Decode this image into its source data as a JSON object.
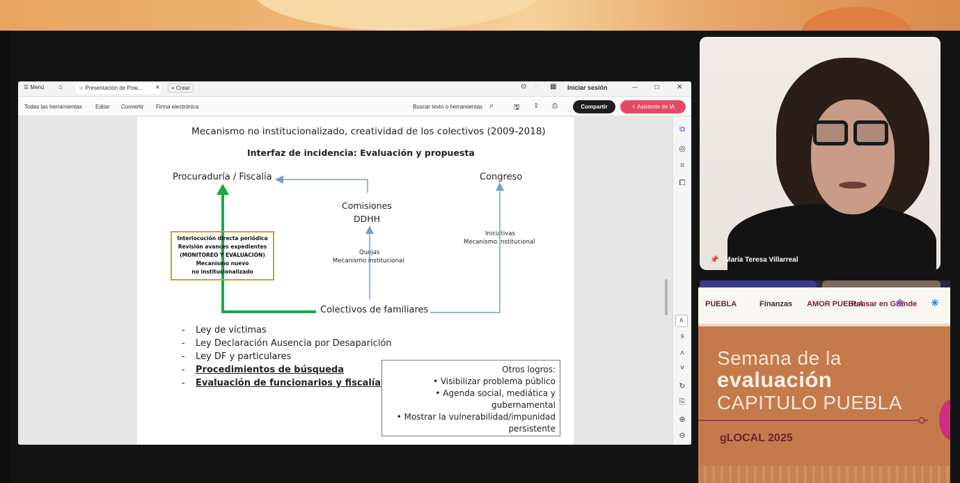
{
  "titlebar": {
    "menu_label": "Menú",
    "tab_title": "Presentación de Pow...",
    "new_tab_label": "Crear",
    "sign_in": "Iniciar sesión"
  },
  "toolbar": {
    "all_tools": "Todas las herramientas",
    "edit": "Editar",
    "convert": "Convertir",
    "esign": "Firma electrónica",
    "search_placeholder": "Buscar texto o herramientas",
    "share_button": "Compartir",
    "ai_button": "Asistente de IA"
  },
  "viewer": {
    "page_number": "6",
    "page_total": "9"
  },
  "slide": {
    "title": "Mecanismo no institucionalizado, creatividad de los colectivos  (2009-2018)",
    "subtitle": "Interfaz de incidencia: Evaluación y propuesta",
    "node_procuraduria": "Procuraduría / Fiscalía",
    "node_congreso": "Congreso",
    "node_comisiones_1": "Comisiones",
    "node_comisiones_2": "DDHH",
    "label_quejas_1": "Quejas",
    "label_quejas_2": "Mecanismo institucional",
    "label_iniciativas_1": "Iniciativas",
    "label_iniciativas_2": "Mecanismo institucional",
    "node_colectivos": "Colectivos de familiares",
    "yellow_box": [
      "Interlocución directa periódica",
      "Revisión avances expedientes",
      "(MONITOREO Y EVALUACIÓN)",
      "Mecanismo nuevo",
      "no institucionalizado"
    ],
    "bullets": [
      {
        "text": "Ley de víctimas",
        "emphasis": false
      },
      {
        "text": "Ley Declaración Ausencia por Desaparición",
        "emphasis": false
      },
      {
        "text": "Ley DF y particulares",
        "emphasis": false
      },
      {
        "text": "Procedimientos de búsqueda",
        "emphasis": true
      },
      {
        "text": "Evaluación de funcionarios y fiscalías",
        "emphasis": true
      }
    ],
    "otros_title": "Otros logros:",
    "otros_items": [
      "•  Visibilizar problema público",
      "•  Agenda social, mediática y",
      "gubernamental",
      "•  Mostrar la vulnerabilidad/impunidad",
      "persistente"
    ]
  },
  "webcam": {
    "participant_name": "María Teresa Villarreal"
  },
  "event": {
    "logos": [
      "PUEBLA",
      "Finanzas",
      "AMOR PUEBLA",
      "Pensar en Grande"
    ],
    "title_line1": "Semana de la",
    "title_line2": "evaluación",
    "title_line3": "CAPITULO PUEBLA",
    "footer": "gLOCAL 2025"
  },
  "colors": {
    "green_arrow": "#19a94a",
    "blue_arrow": "#6ea2cf",
    "yellow_box_border": "#c9a227",
    "share_bg": "#1e1e1e",
    "ai_bg": "#e44a66",
    "event_bg": "#c57a4b",
    "glocal": "#6e1f33"
  }
}
